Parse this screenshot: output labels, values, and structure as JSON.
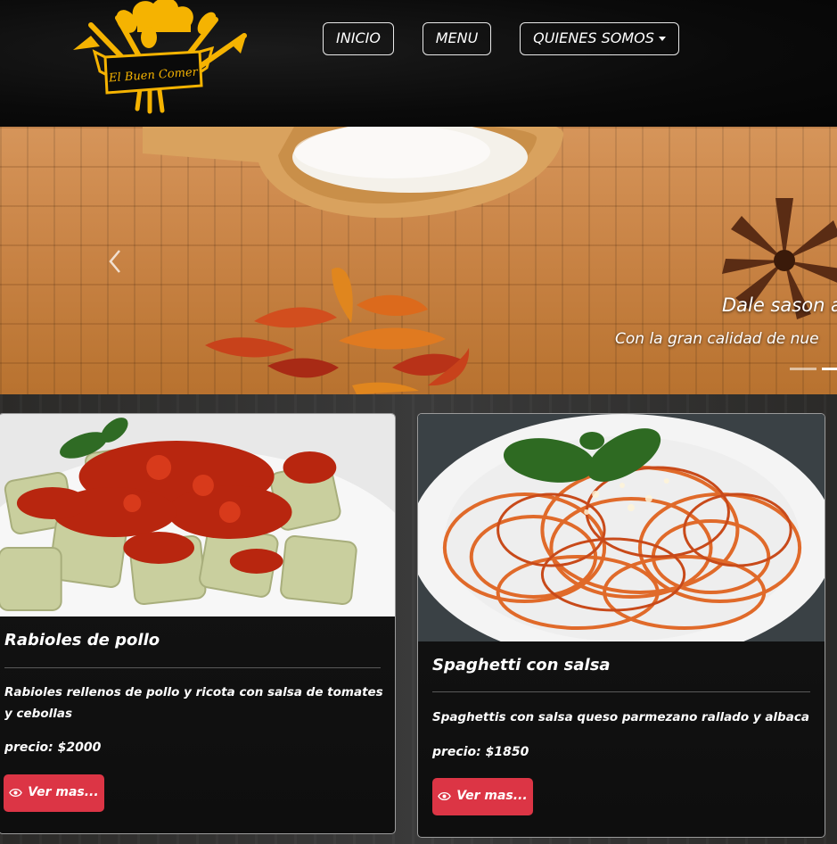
{
  "header": {
    "logo_text": "El Buen Comer",
    "nav": {
      "inicio": "INICIO",
      "menu": "MENU",
      "quienes_somos": "QUIENES SOMOS"
    }
  },
  "carousel": {
    "caption_title": "Dale sason a",
    "caption_text": "Con la gran calidad de nue",
    "slide_count": 2,
    "active_slide": 2
  },
  "cards": [
    {
      "title": "Rabioles de pollo",
      "description": "Rabioles rellenos de pollo y ricota con salsa de tomates y cebollas",
      "price": "precio: $2000",
      "button": "Ver mas..."
    },
    {
      "title": "Spaghetti con salsa",
      "description": "Spaghettis con salsa queso parmezano rallado y albaca",
      "price": "precio: $1850",
      "button": "Ver mas..."
    }
  ],
  "colors": {
    "logo_gold": "#f5b301",
    "button_red": "#dc3545",
    "header_bg": "#0a0a0a"
  },
  "icons": [
    "chef-logo-icon",
    "chevron-left-icon",
    "eye-icon"
  ]
}
